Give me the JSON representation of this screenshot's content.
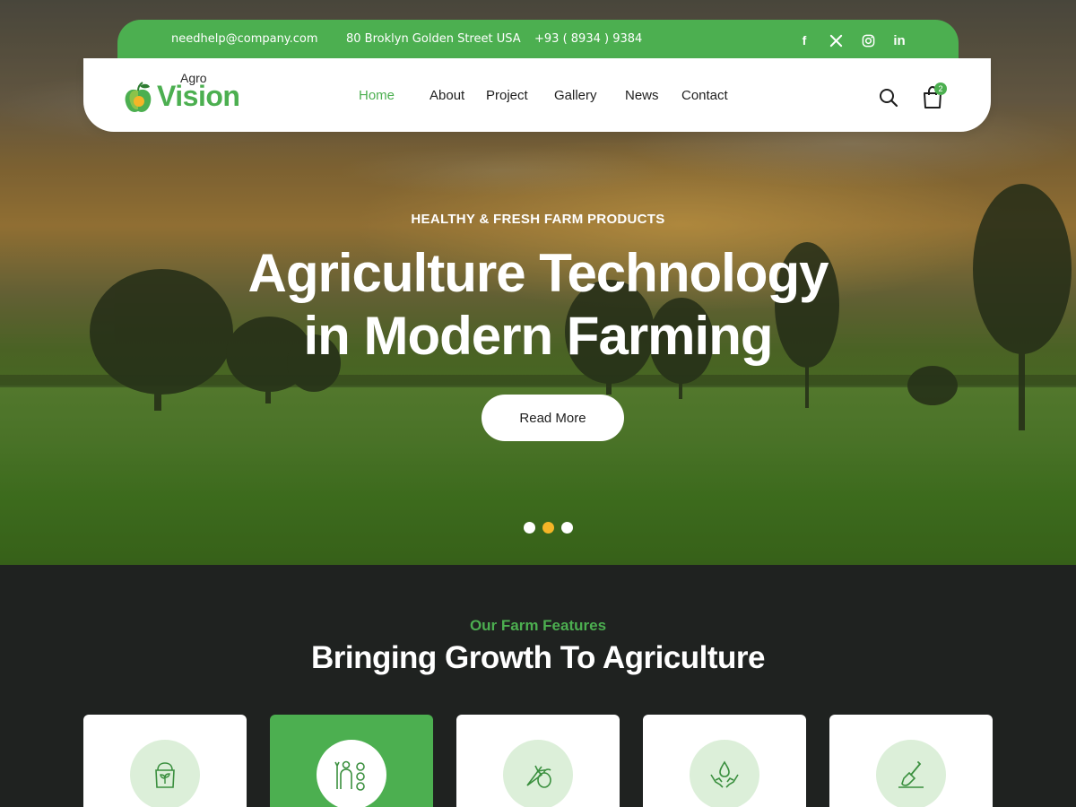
{
  "topbar": {
    "email": "needhelp@company.com",
    "address": "80 Broklyn Golden Street USA",
    "phone": "+93 ( 8934 ) 9384",
    "social": [
      "facebook-icon",
      "x-icon",
      "instagram-icon",
      "linkedin-icon"
    ],
    "social_glyphs": {
      "facebook": "f",
      "linkedin": "in"
    }
  },
  "logo": {
    "small": "Agro",
    "large": "Vision"
  },
  "nav": {
    "items": [
      "Home",
      "About",
      "Project",
      "Gallery",
      "News",
      "Contact"
    ],
    "active": "Home",
    "cart_count": "2"
  },
  "hero": {
    "tagline": "HEALTHY & FRESH FARM PRODUCTS",
    "headline_line1": "Agriculture Technology",
    "headline_line2": "in Modern Farming",
    "button": "Read More",
    "slides": 3,
    "active_slide": 2
  },
  "features": {
    "subtitle": "Our Farm Features",
    "title": "Bringing Growth To Agriculture",
    "cards": [
      {
        "icon": "seed-bag-icon",
        "active": false
      },
      {
        "icon": "farmer-tools-icon",
        "active": true
      },
      {
        "icon": "vegetables-icon",
        "active": false
      },
      {
        "icon": "water-hands-icon",
        "active": false
      },
      {
        "icon": "shovel-soil-icon",
        "active": false
      }
    ]
  },
  "colors": {
    "primary": "#4caf50",
    "accent": "#f5b527",
    "dark": "#1f2220",
    "light_green": "#dcefd9"
  }
}
